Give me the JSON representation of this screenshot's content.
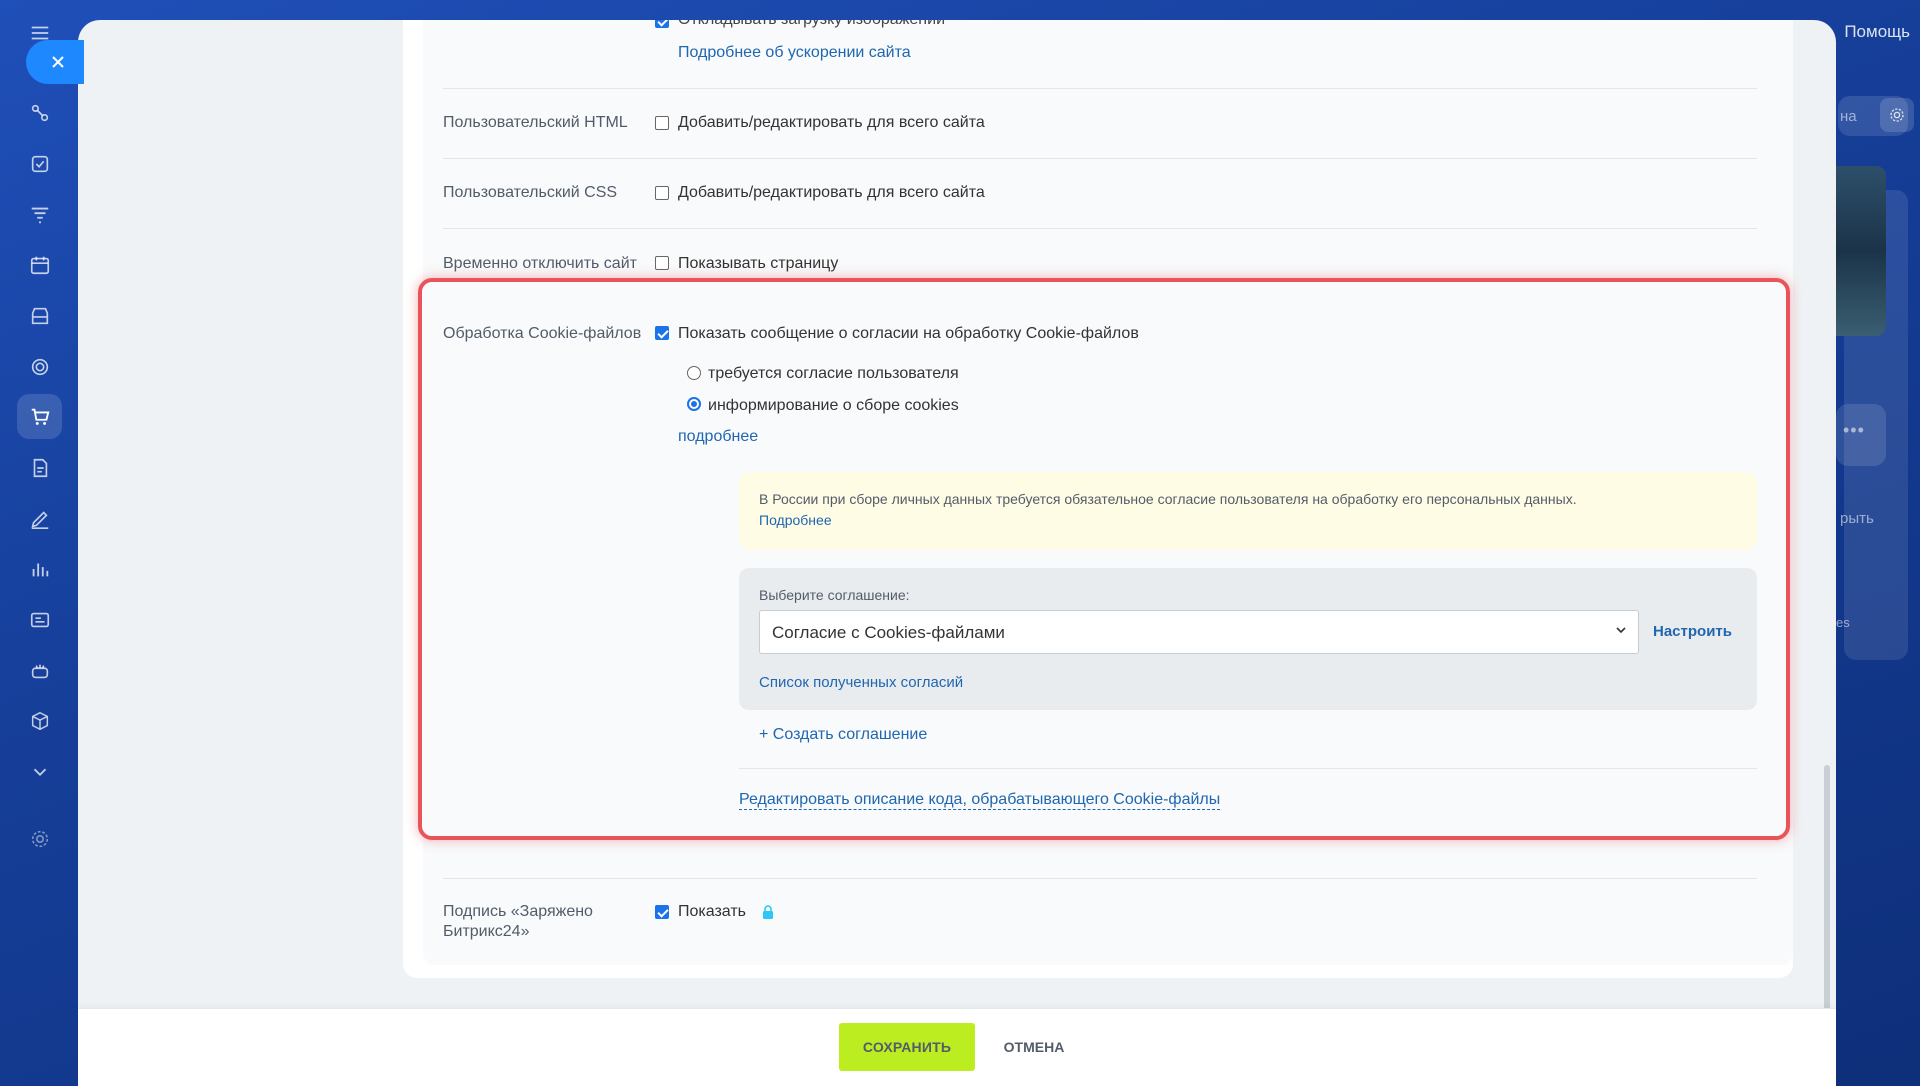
{
  "background": {
    "help_label": "Помощь",
    "peek_texts": [
      "на",
      "рыть",
      "es"
    ]
  },
  "form": {
    "top_rows": {
      "lazy_images_label": "Откладывать загрузку изображений",
      "speed_link": "Подробнее об ускорении сайта"
    },
    "custom_html": {
      "label": "Пользовательский HTML",
      "checkbox_label": "Добавить/редактировать для всего сайта",
      "checked": false
    },
    "custom_css": {
      "label": "Пользовательский CSS",
      "checkbox_label": "Добавить/редактировать для всего сайта",
      "checked": false
    },
    "disable_site": {
      "label": "Временно отключить сайт",
      "checkbox_label": "Показывать страницу",
      "checked": false
    },
    "cookies": {
      "label": "Обработка Cookie-файлов",
      "checkbox_label": "Показать сообщение о согласии на обработку Cookie-файлов",
      "checked": true,
      "radio_options": [
        {
          "label": "требуется согласие пользователя",
          "checked": false
        },
        {
          "label": "информирование о сборе cookies",
          "checked": true
        }
      ],
      "more_link": "подробнее",
      "alert_text": "В России при сборе личных данных требуется обязательное согласие пользователя на обработку его персональных данных.",
      "alert_link": "Подробнее",
      "select_label": "Выберите соглашение:",
      "select_value": "Согласие с Cookies-файлами",
      "configure_label": "Настроить",
      "agreements_list_link": "Список полученных согласий",
      "create_agreement_link": "+ Создать соглашение",
      "edit_code_link": "Редактировать описание кода, обрабатывающего Cookie-файлы"
    },
    "signature": {
      "label_line1": "Подпись «Заряжено",
      "label_line2": "Битрикс24»",
      "checkbox_label": "Показать",
      "checked": true
    }
  },
  "footer": {
    "save_label": "СОХРАНИТЬ",
    "cancel_label": "ОТМЕНА"
  },
  "colors": {
    "accent": "#2066b0",
    "save_button": "#bbed21",
    "highlight_border": "#e8545a",
    "alert_bg": "#fefce4"
  }
}
